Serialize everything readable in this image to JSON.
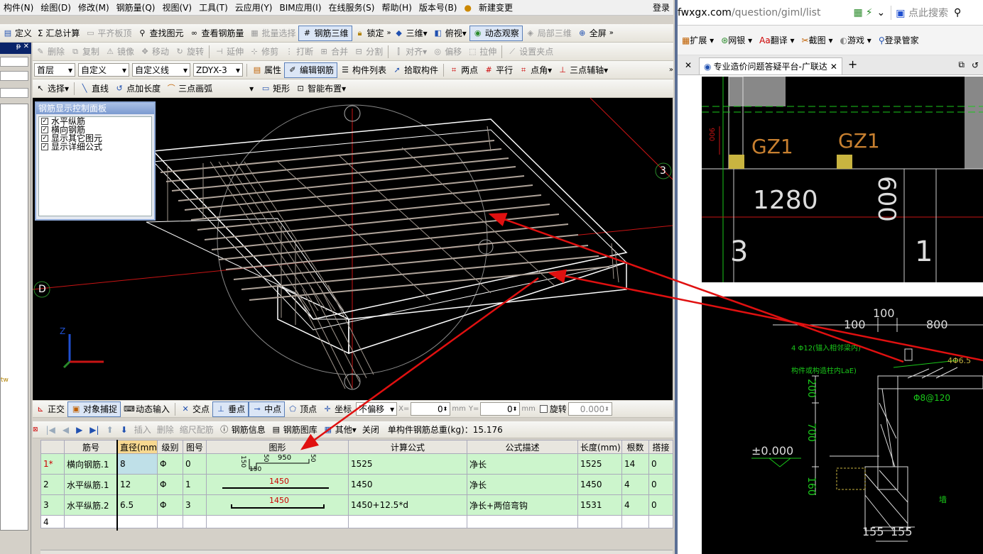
{
  "menu": [
    "构件(N)",
    "绘图(D)",
    "修改(M)",
    "钢筋量(Q)",
    "视图(V)",
    "工具(T)",
    "云应用(Y)",
    "BIM应用(I)",
    "在线服务(S)",
    "帮助(H)",
    "版本号(B)",
    "新建变更"
  ],
  "login": "登录",
  "toolbar1": {
    "define": "定义",
    "summary": "Σ 汇总计算",
    "flat_top": "平齐板顶",
    "find": "查找图元",
    "view_rebar": "查看钢筋量",
    "batch_select": "批量选择",
    "rebar_3d": "钢筋三维",
    "lock": "锁定",
    "view_3d": "三维",
    "top_view": "俯视",
    "dynamic": "动态观察",
    "local_3d": "局部三维",
    "fullscreen": "全屏"
  },
  "toolbar2": [
    "删除",
    "复制",
    "镜像",
    "移动",
    "旋转",
    "延伸",
    "修剪",
    "打断",
    "合并",
    "分割",
    "对齐",
    "偏移",
    "拉伸",
    "设置夹点"
  ],
  "toolbar3": {
    "floor": "首层",
    "custom": "自定义",
    "custom_line": "自定义线",
    "code": "ZDYX-3",
    "props": "属性",
    "edit_rebar": "编辑钢筋",
    "comp_list": "构件列表",
    "pick": "拾取构件",
    "two_pts": "两点",
    "parallel": "平行",
    "pt_angle": "点角",
    "three_pt_axis": "三点辅轴"
  },
  "toolbar4": {
    "select": "选择",
    "line": "直线",
    "pt_length": "点加长度",
    "arc": "三点画弧",
    "rect": "矩形",
    "smart": "智能布置"
  },
  "panel": {
    "title": "钢筋显示控制面板",
    "items": [
      "水平纵筋",
      "横向钢筋",
      "显示其它图元",
      "显示详细公式"
    ]
  },
  "axes": {
    "d": "D",
    "three": "3",
    "z": "Z"
  },
  "snapbar": {
    "ortho": "正交",
    "osnap": "对象捕捉",
    "dyn": "动态输入",
    "intersect": "交点",
    "perp": "垂点",
    "mid": "中点",
    "vertex": "顶点",
    "coord": "坐标",
    "offset": "不偏移",
    "x_label": "X=",
    "x_val": "0",
    "y_label": "Y=",
    "y_val": "0",
    "mm": "mm",
    "rotate": "旋转",
    "rot_val": "0.000"
  },
  "gridbar": {
    "insert": "插入",
    "delete": "删除",
    "scale": "缩尺配筋",
    "info": "钢筋信息",
    "lib": "钢筋图库",
    "other": "其他",
    "close": "关闭",
    "total": "单构件钢筋总重(kg)：15.176"
  },
  "table": {
    "headers": [
      "",
      "筋号",
      "直径(mm)",
      "级别",
      "图号",
      "图形",
      "计算公式",
      "公式描述",
      "长度(mm)",
      "根数",
      "搭接"
    ],
    "rows": [
      {
        "idx": "1*",
        "name": "横向钢筋.1",
        "dia": "8",
        "grade": "Φ",
        "fig": "0",
        "shape_main": "950",
        "shape_side_l": "150",
        "shape_side_b": "150",
        "shape_d1": "50",
        "shape_d2": "50",
        "formula": "1525",
        "desc": "净长",
        "len": "1525",
        "count": "14",
        "lap": "0"
      },
      {
        "idx": "2",
        "name": "水平纵筋.1",
        "dia": "12",
        "grade": "Φ",
        "fig": "1",
        "shape_main": "1450",
        "formula": "1450",
        "desc": "净长",
        "len": "1450",
        "count": "4",
        "lap": "0"
      },
      {
        "idx": "3",
        "name": "水平纵筋.2",
        "dia": "6.5",
        "grade": "Φ",
        "fig": "3",
        "shape_main": "1450",
        "formula": "1450+12.5*d",
        "desc": "净长+两倍弯钩",
        "len": "1531",
        "count": "4",
        "lap": "0"
      },
      {
        "idx": "4"
      }
    ]
  },
  "browser": {
    "url_host": "fwxgx.com",
    "url_path": "/question/giml/list",
    "search": "点此搜索",
    "ext": [
      "扩展",
      "网银",
      "翻译",
      "截图",
      "游戏",
      "登录管家"
    ],
    "tab": "专业造价问题答疑平台-广联达"
  },
  "cad1": {
    "gz": "GZ1",
    "n1280": "1280",
    "n600": "600",
    "n900": "900",
    "n3": "3",
    "n1": "1"
  },
  "cad2": {
    "n100a": "100",
    "n100b": "100",
    "n800": "800",
    "top_note": "4 Φ12(锚入相邻梁内)",
    "anchor": "构件或构造柱内LaE)",
    "side_note": "4Φ6.5",
    "n200": "200",
    "n700": "700",
    "n160": "160",
    "hoop": "Φ8@120",
    "zero": "±0.000",
    "n155a": "155",
    "n155b": "155",
    "wall": "墙"
  },
  "leftedge": "tw"
}
